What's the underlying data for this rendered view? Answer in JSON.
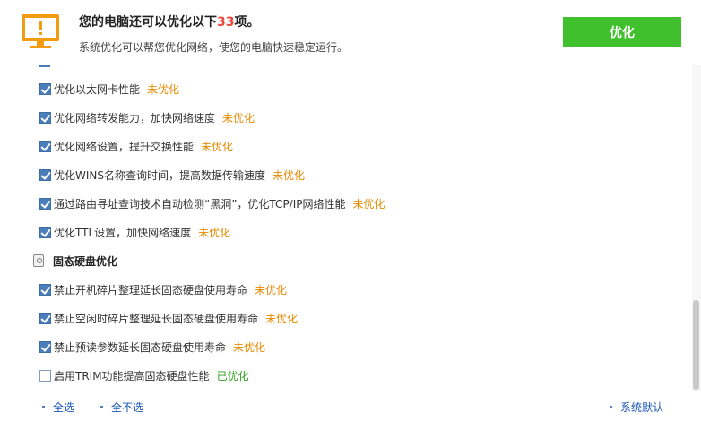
{
  "header": {
    "title_prefix": "您的电脑还可以优化以下",
    "count": "33",
    "title_suffix": "项。",
    "subtitle": "系统优化可以帮您优化网络，使您的电脑快速稳定运行。",
    "optimize_label": "优化"
  },
  "items": [
    {
      "label": "优化以太网卡性能",
      "status": "未优化"
    },
    {
      "label": "优化网络转发能力，加快网络速度",
      "status": "未优化"
    },
    {
      "label": "优化网络设置，提升交换性能",
      "status": "未优化"
    },
    {
      "label": "优化WINS名称查询时间，提高数据传输速度",
      "status": "未优化"
    },
    {
      "label": "通过路由寻址查询技术自动检测“黑洞”，优化TCP/IP网络性能",
      "status": "未优化"
    },
    {
      "label": "优化TTL设置，加快网络速度",
      "status": "未优化"
    }
  ],
  "ssd_section": {
    "title": "固态硬盘优化",
    "items": [
      {
        "label": "禁止开机碎片整理延长固态硬盘使用寿命",
        "status": "未优化"
      },
      {
        "label": "禁止空闲时碎片整理延长固态硬盘使用寿命",
        "status": "未优化"
      },
      {
        "label": "禁止预读参数延长固态硬盘使用寿命",
        "status": "未优化"
      },
      {
        "label": "启用TRIM功能提高固态硬盘性能",
        "status": "已优化"
      }
    ]
  },
  "footer": {
    "select_all": "全选",
    "select_none": "全不选",
    "system_default": "系统默认"
  },
  "colors": {
    "accent_green": "#3fc02c",
    "monitor_orange": "#f39c12",
    "pending": "#e68a00",
    "done": "#2ea01c",
    "link": "#1a56b5"
  }
}
